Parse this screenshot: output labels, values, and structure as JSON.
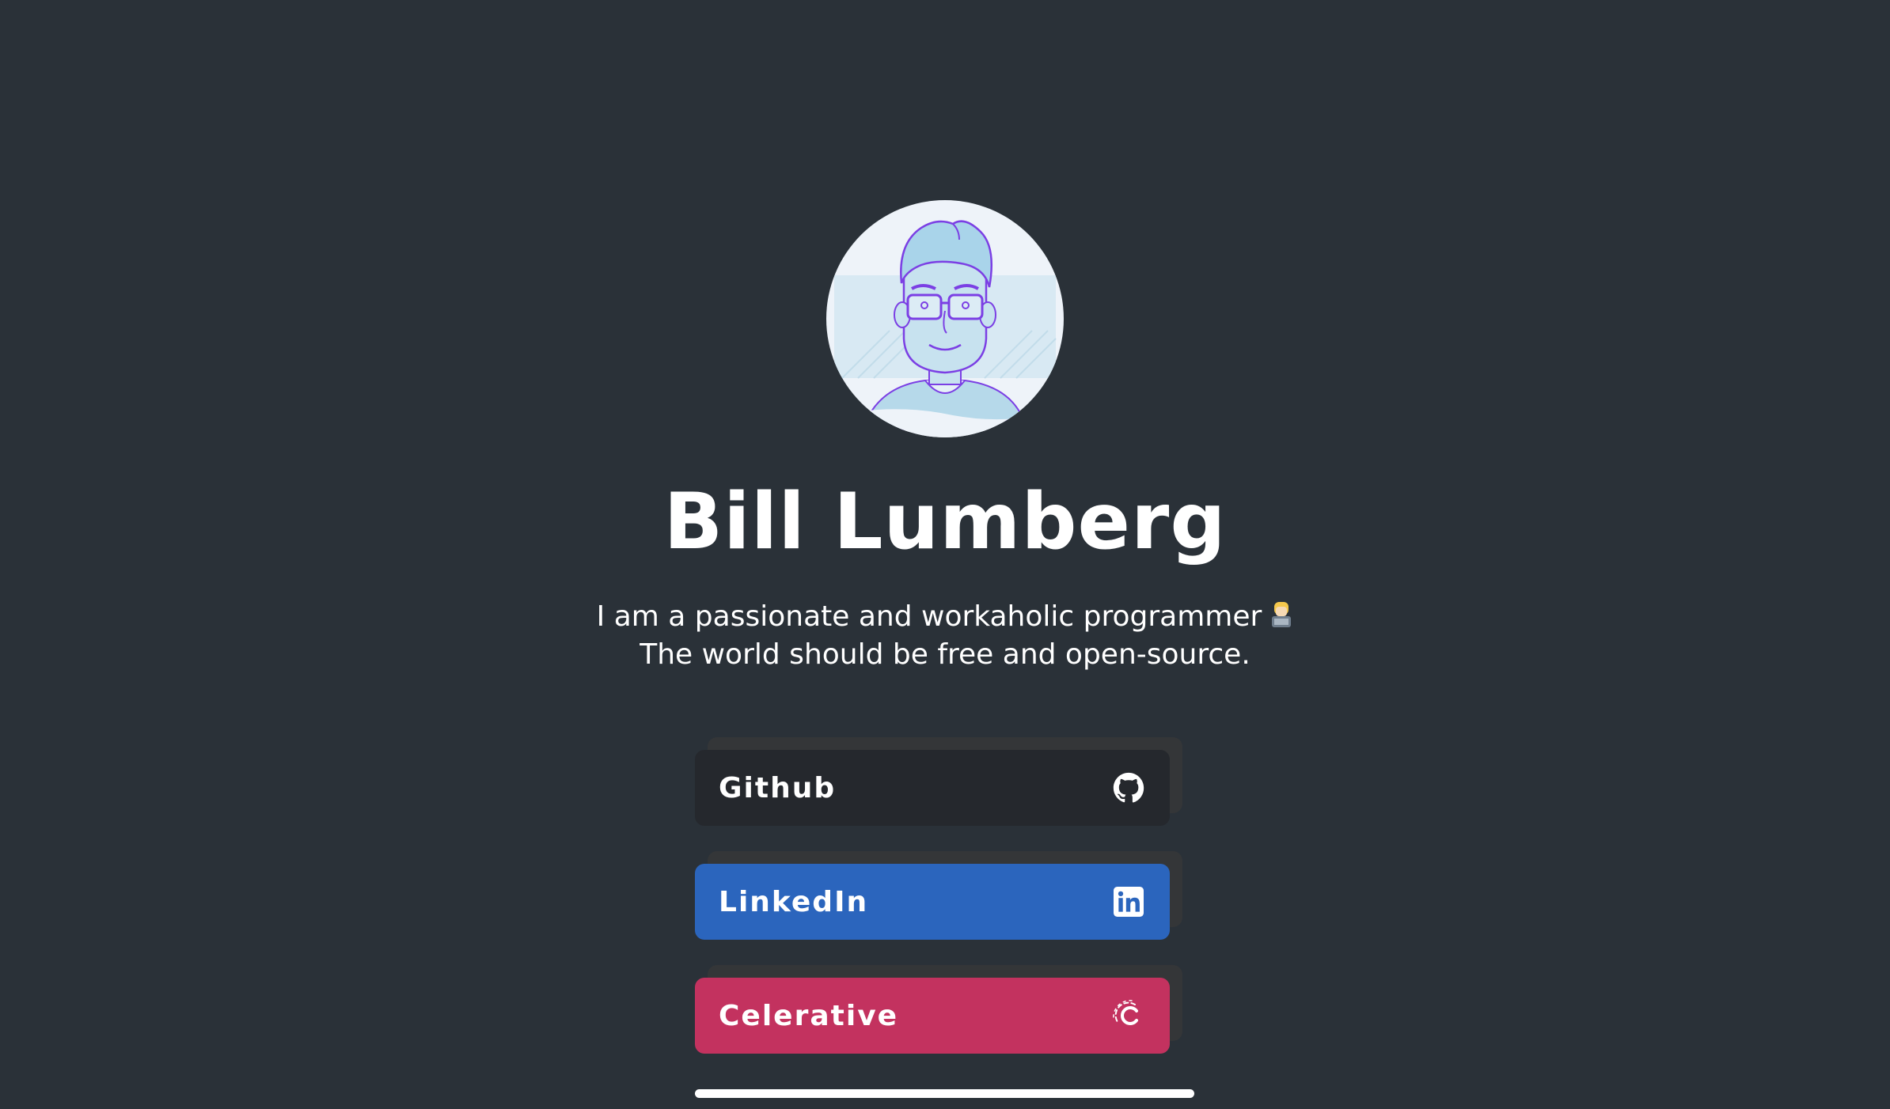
{
  "profile": {
    "name": "Bill Lumberg",
    "bio_line1": "I am a passionate and workaholic programmer",
    "bio_line2": "The world should be free and open-source.",
    "bio_emoji": "technologist-emoji",
    "avatar_icon": "developer-avatar-illustration"
  },
  "links": [
    {
      "label": "Github",
      "icon": "github-icon",
      "color": "#25282d"
    },
    {
      "label": "LinkedIn",
      "icon": "linkedin-icon",
      "color": "#2b65bd"
    },
    {
      "label": "Celerative",
      "icon": "celerative-icon",
      "color": "#c3325f"
    }
  ],
  "colors": {
    "background": "#2a3138",
    "button_shadow": "#343638",
    "text": "#ffffff"
  }
}
